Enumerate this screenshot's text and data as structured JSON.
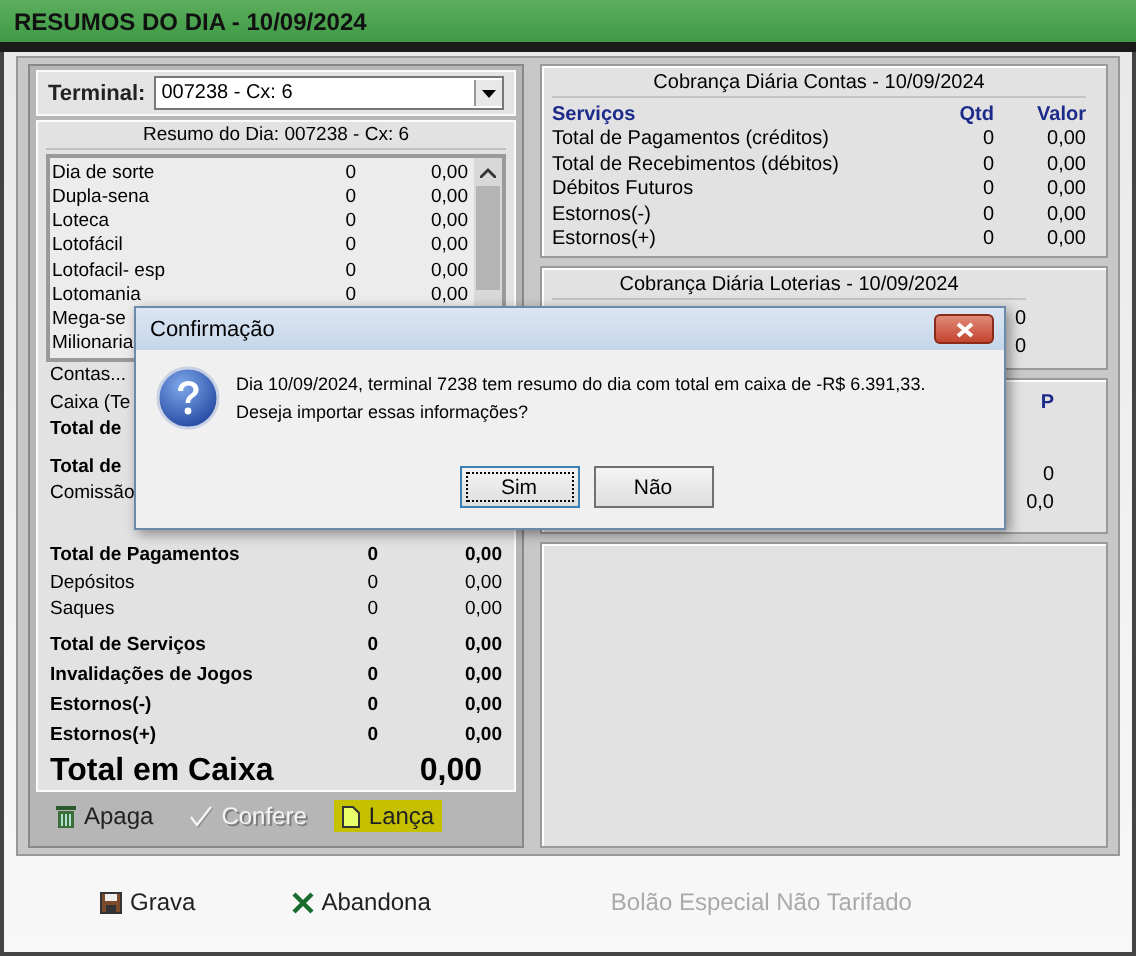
{
  "window": {
    "title": "RESUMOS DO DIA - 10/09/2024"
  },
  "terminal": {
    "label": "Terminal:",
    "value": "007238 - Cx: 6"
  },
  "summary": {
    "title": "Resumo do Dia: 007238 - Cx: 6",
    "games": [
      {
        "name": "Dia de sorte",
        "qtd": "0",
        "valor": "0,00"
      },
      {
        "name": "Dupla-sena",
        "qtd": "0",
        "valor": "0,00"
      },
      {
        "name": "Loteca",
        "qtd": "0",
        "valor": "0,00"
      },
      {
        "name": "Lotofácil",
        "qtd": "0",
        "valor": "0,00"
      },
      {
        "name": "Lotofacil- esp",
        "qtd": "0",
        "valor": "0,00"
      },
      {
        "name": "Lotomania",
        "qtd": "0",
        "valor": "0,00"
      },
      {
        "name": "Mega-se"
      },
      {
        "name": "Milionaria"
      }
    ],
    "partial_rows": [
      {
        "label": "Contas...",
        "bold": false
      },
      {
        "label": "Caixa (Te",
        "bold": false
      },
      {
        "label": "Total de",
        "bold": true
      },
      {
        "label": "Total de",
        "bold": true
      },
      {
        "label": "Comissão",
        "bold": false
      }
    ],
    "totals": [
      {
        "label": "Total de Pagamentos",
        "qtd": "0",
        "valor": "0,00",
        "bold": true
      },
      {
        "label": "Depósitos",
        "qtd": "0",
        "valor": "0,00",
        "bold": false
      },
      {
        "label": "Saques",
        "qtd": "0",
        "valor": "0,00",
        "bold": false
      },
      {
        "label": "Total de Serviços",
        "qtd": "0",
        "valor": "0,00",
        "bold": true
      },
      {
        "label": "Invalidações de Jogos",
        "qtd": "0",
        "valor": "0,00",
        "bold": true
      },
      {
        "label": "Estornos(-)",
        "qtd": "0",
        "valor": "0,00",
        "bold": true
      },
      {
        "label": "Estornos(+)",
        "qtd": "0",
        "valor": "0,00",
        "bold": true
      }
    ],
    "grand_total": {
      "label": "Total em Caixa",
      "value": "0,00"
    }
  },
  "actions": [
    {
      "label": "Apaga",
      "kind": "trash",
      "disabled": false,
      "highlighted": false
    },
    {
      "label": "Confere",
      "kind": "check",
      "disabled": true,
      "highlighted": false
    },
    {
      "label": "Lança",
      "kind": "document",
      "disabled": false,
      "highlighted": true
    }
  ],
  "contas": {
    "title": "Cobrança Diária Contas - 10/09/2024",
    "columns": [
      "Serviços",
      "Qtd",
      "Valor"
    ],
    "rows": [
      {
        "label": "Total de Pagamentos (créditos)",
        "qtd": "0",
        "valor": "0,00"
      },
      {
        "label": "Total de Recebimentos (débitos)",
        "qtd": "0",
        "valor": "0,00"
      },
      {
        "label": "Débitos Futuros",
        "qtd": "0",
        "valor": "0,00"
      },
      {
        "label": "Estornos(-)",
        "qtd": "0",
        "valor": "0,00"
      },
      {
        "label": "Estornos(+)",
        "qtd": "0",
        "valor": "0,00"
      }
    ]
  },
  "loterias": {
    "title": "Cobrança Diária Loterias - 10/09/2024",
    "values": [
      "0",
      "0"
    ]
  },
  "panel_3": {
    "heading": "P",
    "values": [
      "0",
      "0,0"
    ]
  },
  "bottom": [
    {
      "label": "Grava",
      "kind": "save",
      "disabled": false
    },
    {
      "label": "Abandona",
      "kind": "cancel",
      "disabled": false
    },
    {
      "label": "Bolão Especial Não Tarifado",
      "kind": "text",
      "disabled": true
    }
  ],
  "dialog": {
    "title": "Confirmação",
    "lines": [
      "Dia 10/09/2024, terminal 7238 tem resumo do dia com total em caixa de -R$ 6.391,33.",
      "Deseja importar essas informações?"
    ],
    "buttons": [
      {
        "label": "Sim",
        "focused": true
      },
      {
        "label": "Não",
        "focused": false
      }
    ]
  }
}
